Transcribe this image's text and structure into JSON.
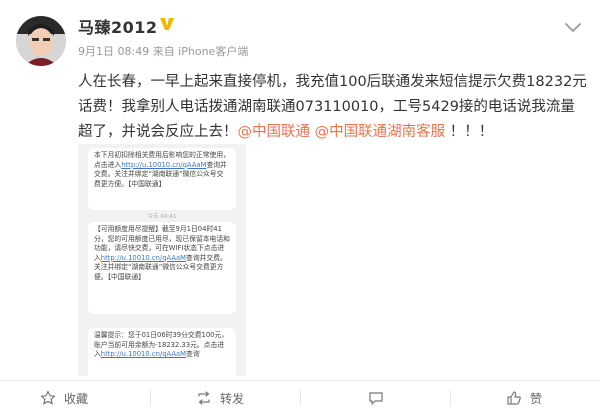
{
  "user": {
    "name": "马臻2012",
    "meta": "9月1日 08:49 来自 iPhone客户端"
  },
  "post": {
    "text_pre": "人在长春，一早上起来直接停机，我充值100后联通发来短信提示欠费18232元话费！我拿别人电话拨通湖南联通073110010，工号5429接的电话说我流量超了，并说会反应上去！",
    "mention_1": "@中国联通",
    "mention_2": "@中国联通湖南客服",
    "text_post": "！！！"
  },
  "sms": {
    "msg1": "本下月初扣除相关费用后影响您的正常使用，点击进入",
    "msg1_link": "http://u.10010.cn/qAAaM",
    "msg1_b": "查询并交费。关注并绑定“湖南联通”微信公众号交费更方便。【中国联通】",
    "time1": "今天 04:41",
    "msg2": "【可用额度用尽提醒】截至9月1日04时41分，您的可用额度已用尽，现已保留本电话和功能，请尽快交费，可在WIFI状态下点击进入",
    "msg2_link": "http://u.10010.cn/qAAaM",
    "msg2_b": "查询并交费。关注并绑定“湖南联通”微信公众号交费更方便。【中国联通】",
    "msg3": "温馨提示：您于01日06时39分交费100元，账户当前可用余额为-18232.33元。点击进入",
    "msg3_link": "http://u.10010.cn/qAAaM",
    "msg3_b": "查询"
  },
  "actions": {
    "favorite": "收藏",
    "repost": "转发",
    "like": "赞"
  },
  "colors": {
    "mention": "#eb7350",
    "verified": "#f6b500",
    "meta": "#999999"
  },
  "icons": [
    "avatar",
    "verified-icon",
    "chevron-down-icon",
    "favorite-icon",
    "repost-icon",
    "comment-icon",
    "like-icon"
  ]
}
